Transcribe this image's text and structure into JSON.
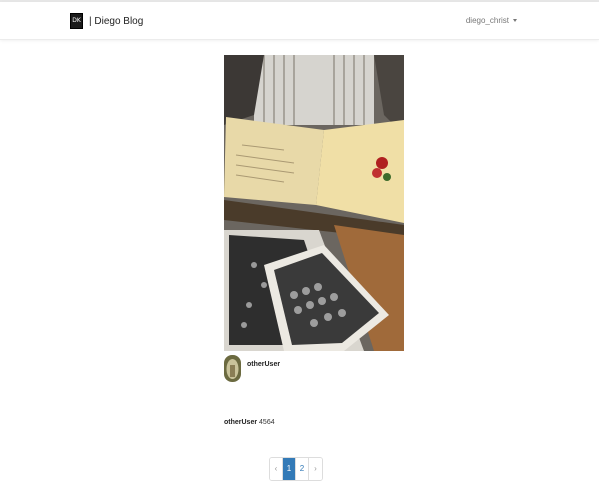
{
  "navbar": {
    "logo_text": "DK",
    "brand": "| Diego Blog",
    "user": "diego_christ"
  },
  "post": {
    "image_icon": "vintage-photos-scrapbook",
    "author": "otherUser",
    "caption_user": "otherUser",
    "caption_text": "4564"
  },
  "pagination": {
    "prev": "‹",
    "pages": [
      "1",
      "2"
    ],
    "next": "›",
    "active": "1"
  },
  "colors": {
    "accent": "#337ab7",
    "navbar_bg": "#ffffff"
  }
}
